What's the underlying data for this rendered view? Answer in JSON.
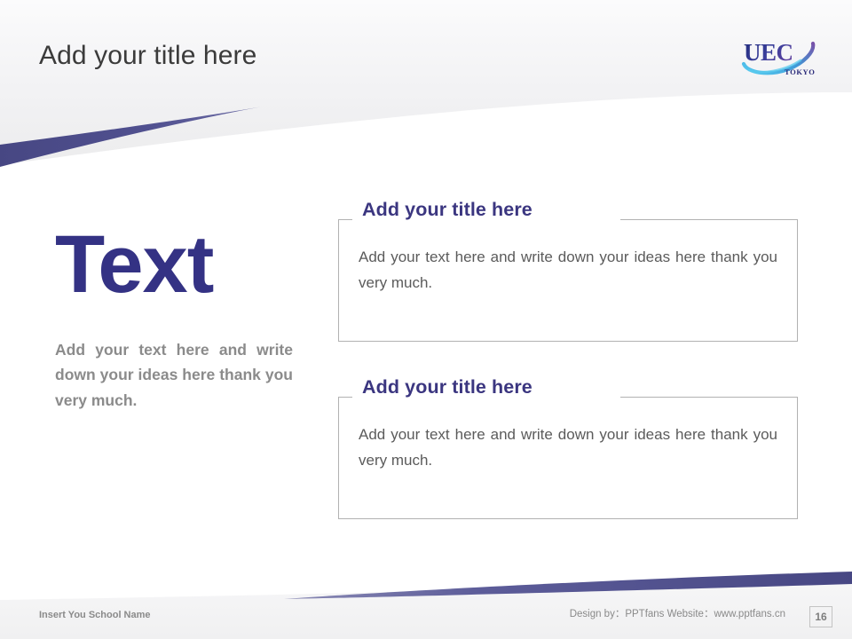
{
  "slide": {
    "title": "Add your title here",
    "accent_purple": "#4a4a8e",
    "accent_deep_blue": "#343284",
    "title_color": "#3b3b3b"
  },
  "logo": {
    "name": "uec-tokyo-logo",
    "wordmark": "UEC",
    "subtext": "TOKYO",
    "color_dark": "#2b2b7a",
    "color_light": "#2f9fd8"
  },
  "left": {
    "big_word": "Text",
    "body": "Add your text here and write down your ideas here thank you very much."
  },
  "panels": [
    {
      "title": "Add your title here",
      "body": "Add your text here and write down your ideas here thank you very much."
    },
    {
      "title": "Add your title here",
      "body": "Add your text here and write down your ideas here thank you very much."
    }
  ],
  "footer": {
    "school_name": "Insert You School Name",
    "credit": "Design by：PPTfans  Website：www.pptfans.cn",
    "page_number": "16"
  }
}
